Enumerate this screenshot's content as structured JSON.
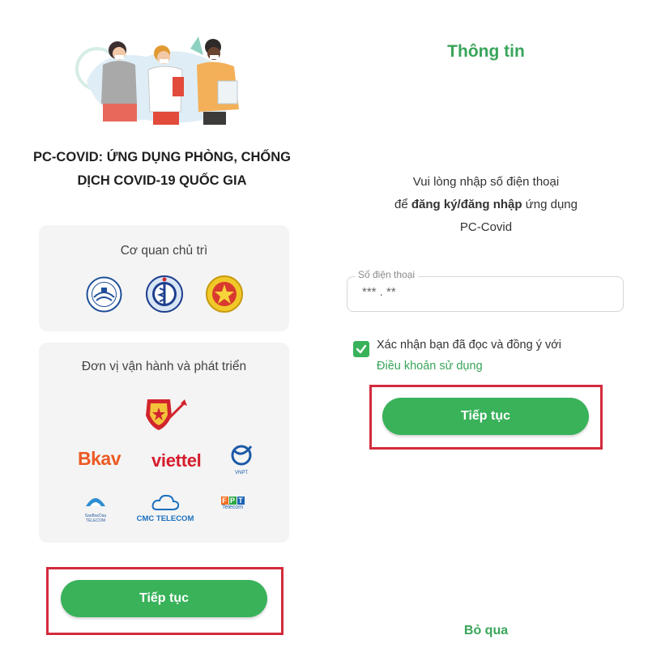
{
  "left": {
    "app_title_line1": "PC-COVID: ỨNG DỤNG PHÒNG, CHỐNG",
    "app_title_line2": "DỊCH COVID-19 QUỐC GIA",
    "host_card_title": "Cơ quan chủ trì",
    "dev_card_title": "Đơn vị vận hành và phát triển",
    "partners": {
      "bkav": "Bkav",
      "viettel": "viettel",
      "vnpt": "VNPT",
      "sbd_top": "SaoBacDau",
      "sbd_bottom": "TELECOM",
      "cmc": "CMC TELECOM",
      "fpt": "FPT",
      "fpt_sub": "Telecom"
    },
    "continue_label": "Tiếp tục"
  },
  "right": {
    "screen_title": "Thông tin",
    "instruction_line1": "Vui lòng nhập số điện thoại",
    "instruction_pre": "để ",
    "instruction_bold": "đăng ký/đăng nhập",
    "instruction_post": " ứng dụng",
    "instruction_line3": "PC-Covid",
    "phone_label": "Số điện thoại",
    "phone_value": "*** . **",
    "consent_text": "Xác nhận bạn đã đọc và đồng ý với",
    "terms_link": "Điều khoản sử dụng",
    "continue_label": "Tiếp tục",
    "skip_label": "Bỏ qua",
    "consent_checked": true
  },
  "colors": {
    "primary_green": "#39b25a",
    "highlight_red": "#d22b3c",
    "card_bg": "#f4f4f4"
  }
}
